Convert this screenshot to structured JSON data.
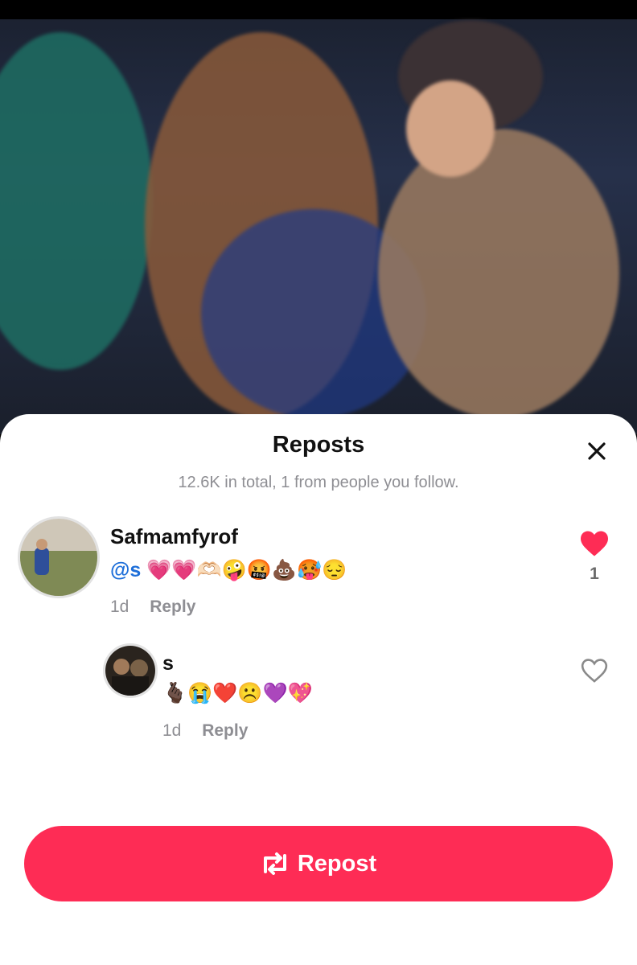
{
  "sheet": {
    "title": "Reposts",
    "subtitle": "12.6K in total, 1 from people you follow."
  },
  "comments": [
    {
      "username": "Safmamfyrof",
      "mention": "@s",
      "text": "💗💗🫶🏻🤪🤬💩🥵😔",
      "time": "1d",
      "reply_label": "Reply",
      "like_count": "1",
      "liked": true
    },
    {
      "username": "s",
      "text": "🫰🏿😭❤️☹️💜💖",
      "time": "1d",
      "reply_label": "Reply",
      "liked": false
    }
  ],
  "repost_button": {
    "label": "Repost"
  },
  "colors": {
    "accent": "#fe2c55",
    "mention": "#1e6fd9",
    "muted": "#8e8e93"
  },
  "icons": [
    "close-icon",
    "heart-filled-icon",
    "heart-outline-icon",
    "repost-icon"
  ]
}
